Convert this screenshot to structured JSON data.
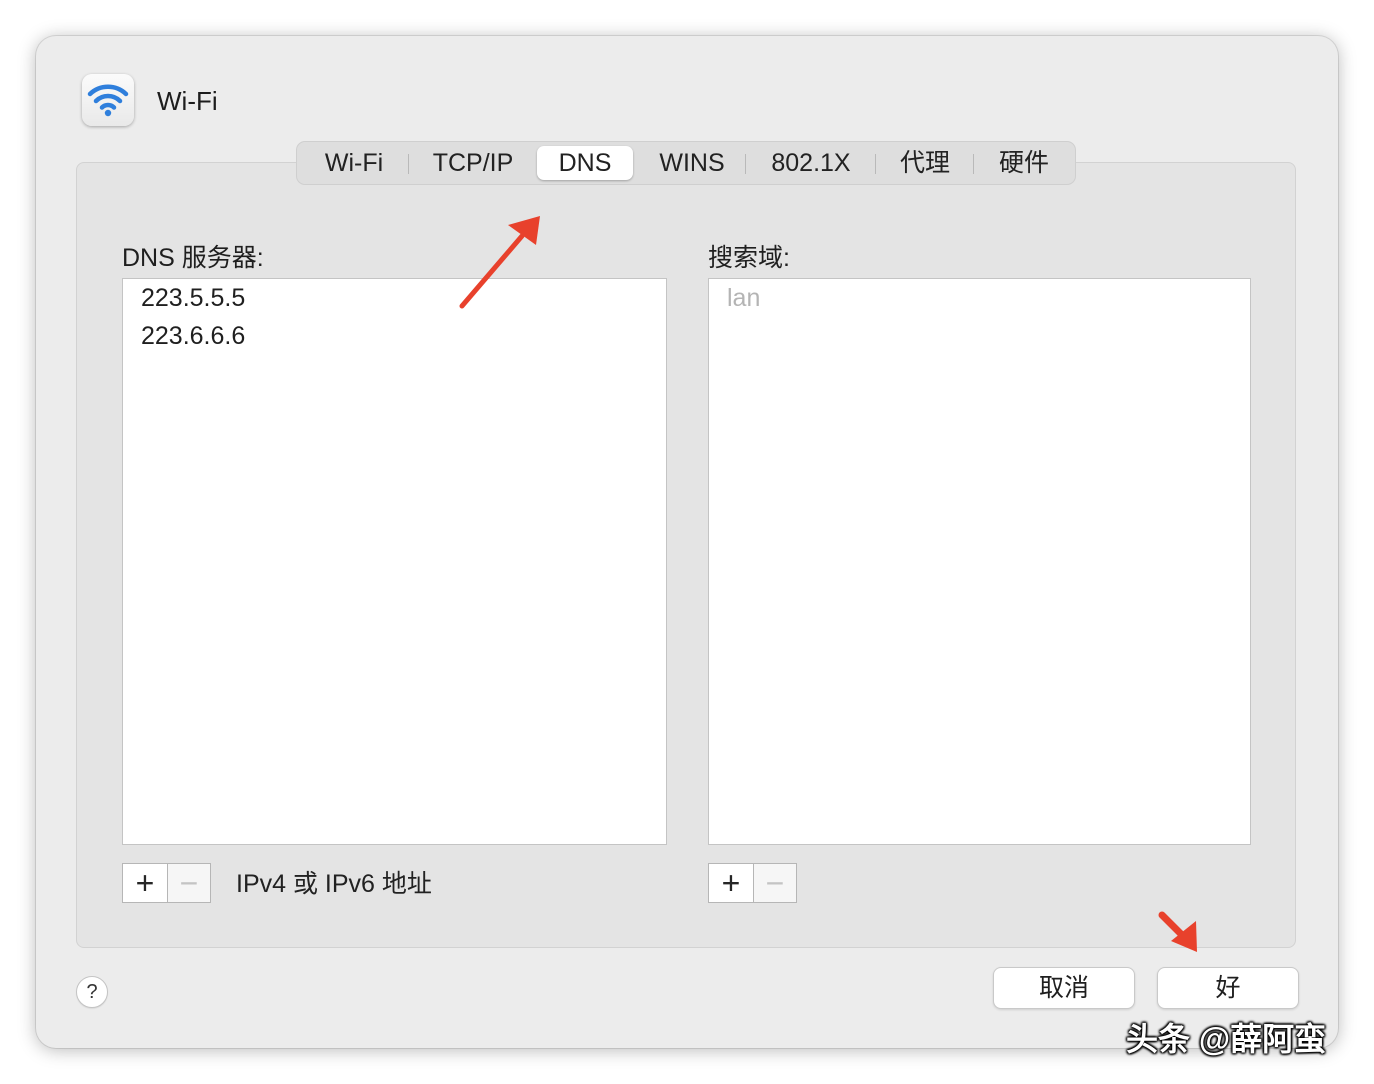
{
  "window": {
    "title": "Wi-Fi"
  },
  "tabs": [
    {
      "label": "Wi-Fi",
      "active": false
    },
    {
      "label": "TCP/IP",
      "active": false
    },
    {
      "label": "DNS",
      "active": true
    },
    {
      "label": "WINS",
      "active": false
    },
    {
      "label": "802.1X",
      "active": false
    },
    {
      "label": "代理",
      "active": false
    },
    {
      "label": "硬件",
      "active": false
    }
  ],
  "dns": {
    "label": "DNS 服务器:",
    "servers": [
      "223.5.5.5",
      "223.6.6.6"
    ],
    "add_label": "+",
    "remove_label": "−",
    "hint": "IPv4 或 IPv6 地址"
  },
  "search_domains": {
    "label": "搜索域:",
    "placeholder": "lan",
    "add_label": "+",
    "remove_label": "−"
  },
  "help_label": "?",
  "buttons": {
    "cancel": "取消",
    "ok": "好"
  },
  "watermark": "头条 @薛阿蛮",
  "icons": {
    "app": "wifi-icon"
  },
  "colors": {
    "wifi_blue": "#2f7fdc",
    "arrow_red": "#e8412c"
  }
}
